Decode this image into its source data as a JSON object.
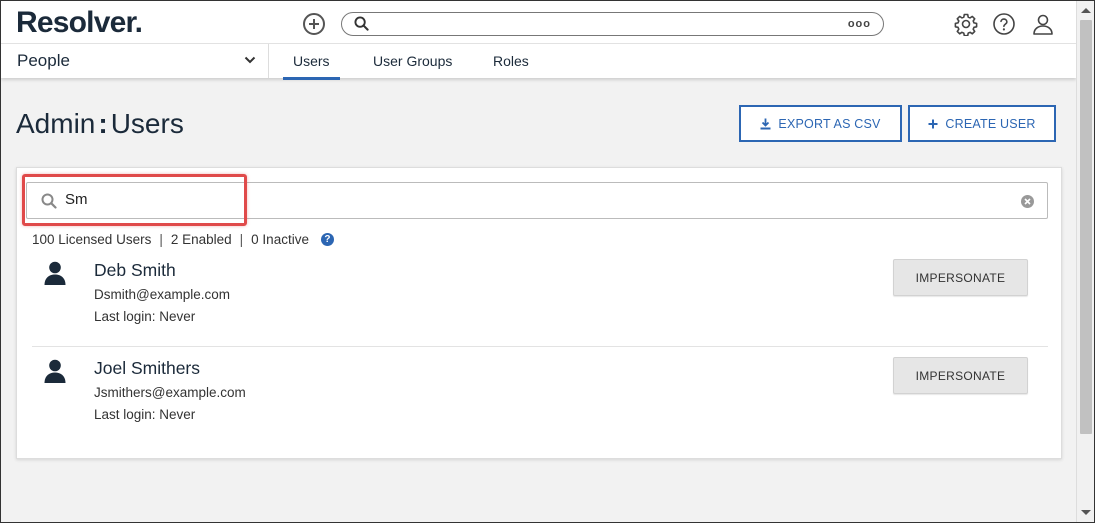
{
  "header": {
    "logo": "Resolver.",
    "search": {
      "value": "",
      "placeholder": ""
    },
    "more_label": "ooo"
  },
  "nav": {
    "app_name": "People",
    "tabs": [
      {
        "label": "Users",
        "active": true
      },
      {
        "label": "User Groups",
        "active": false
      },
      {
        "label": "Roles",
        "active": false
      }
    ]
  },
  "page": {
    "title_prefix": "Admin",
    "title_separator": ":",
    "title": "Users",
    "export_label": "EXPORT AS CSV",
    "create_label": "CREATE USER"
  },
  "filter": {
    "value": "Sm"
  },
  "stats": {
    "licensed": "100 Licensed Users",
    "enabled": "2 Enabled",
    "inactive": "0 Inactive",
    "separator": "|",
    "help": "?"
  },
  "users": [
    {
      "name": "Deb Smith",
      "email": "Dsmith@example.com",
      "last_login": "Last login: Never",
      "action_label": "IMPERSONATE"
    },
    {
      "name": "Joel Smithers",
      "email": "Jsmithers@example.com",
      "last_login": "Last login: Never",
      "action_label": "IMPERSONATE"
    }
  ],
  "colors": {
    "accent": "#2c66b3",
    "text": "#1b2a3a",
    "highlight": "#e04a4a"
  }
}
